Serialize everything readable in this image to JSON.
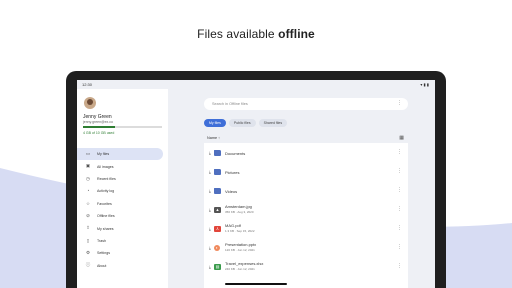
{
  "headline": {
    "prefix": "Files available",
    "bold": "offline"
  },
  "status_bar": {
    "time": "12:30",
    "icons": "▾ ▮ ▮"
  },
  "user": {
    "name": "Jenny Green",
    "email": "jenny.green@ex.co",
    "storage": "4 GB of 10 GB used",
    "storage_fraction": 0.4
  },
  "nav": [
    {
      "label": "My files",
      "icon": "folder-icon",
      "glyph": "▭",
      "active": true
    },
    {
      "label": "All images",
      "icon": "image-icon",
      "glyph": "▣"
    },
    {
      "label": "Recent files",
      "icon": "recent-icon",
      "glyph": "◷"
    },
    {
      "label": "Activity log",
      "icon": "activity-icon",
      "glyph": "◔"
    },
    {
      "label": "Favorites",
      "icon": "star-icon",
      "glyph": "☆"
    },
    {
      "label": "Offline files",
      "icon": "offline-icon",
      "glyph": "⊘"
    },
    {
      "label": "My shares",
      "icon": "share-icon",
      "glyph": "⇪"
    },
    {
      "label": "Trash",
      "icon": "trash-icon",
      "glyph": "▯"
    },
    {
      "label": "Settings",
      "icon": "gear-icon",
      "glyph": "⚙"
    },
    {
      "label": "About",
      "icon": "info-icon",
      "glyph": "ⓘ"
    }
  ],
  "search": {
    "placeholder": "Search in Offline files"
  },
  "chips": [
    {
      "label": "My files",
      "active": true
    },
    {
      "label": "Public files"
    },
    {
      "label": "Shared files"
    }
  ],
  "list_header": {
    "sort_label": "Name ↑"
  },
  "files": [
    {
      "name": "Documents",
      "type": "folder",
      "meta": ""
    },
    {
      "name": "Pictures",
      "type": "folder",
      "meta": ""
    },
    {
      "name": "Videos",
      "type": "folder",
      "meta": ""
    },
    {
      "name": "Amsterdam.jpg",
      "type": "image",
      "meta": "356 KB · Aug 3, 2020"
    },
    {
      "name": "MAG.pdf",
      "type": "pdf",
      "meta": "1.3 KB · Sep 15, 2022"
    },
    {
      "name": "Presentation.pptx",
      "type": "ppt",
      "meta": "120 KB · Jun 12, 2021"
    },
    {
      "name": "Travel_expenses.xlsx",
      "type": "xls",
      "meta": "240 KB · Jun 12, 2021"
    }
  ],
  "colors": {
    "accent": "#3f6fd8",
    "nav_active": "#dde3f5",
    "storage": "#2e7d32",
    "folder": "#4f6fbf"
  }
}
